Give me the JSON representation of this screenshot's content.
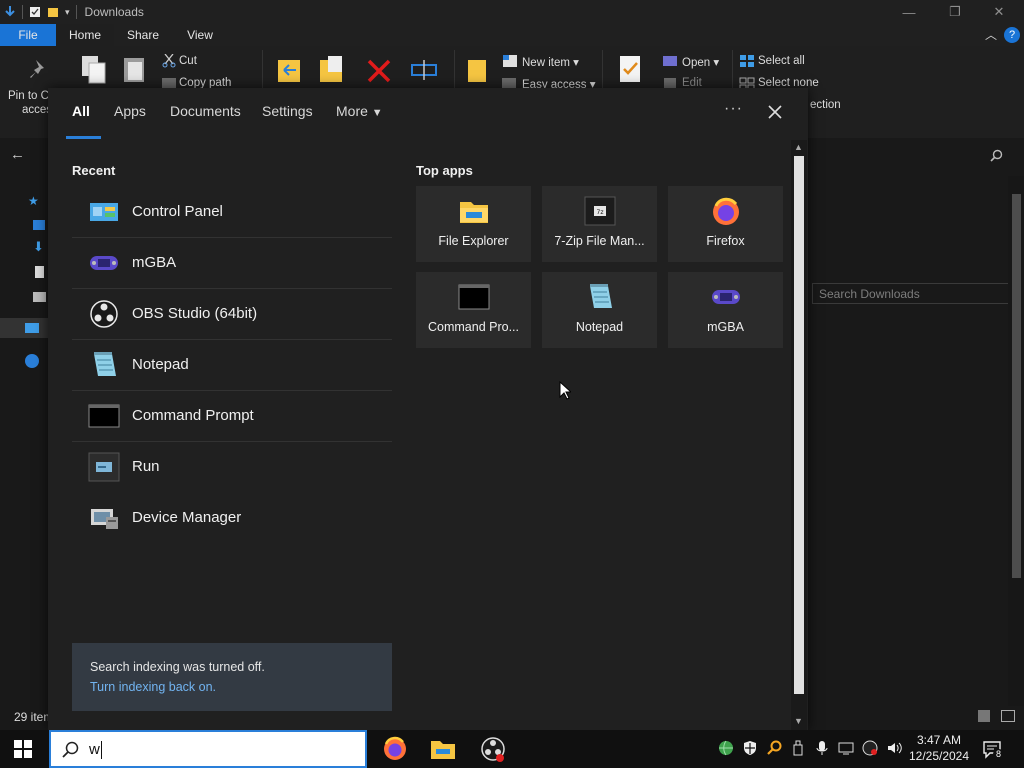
{
  "window": {
    "title": "Downloads",
    "tabs": {
      "file": "File",
      "home": "Home",
      "share": "Share",
      "view": "View"
    },
    "ribbon": {
      "pin_label": "Pin to C",
      "pin_label2": "acces",
      "cut": "Cut",
      "copy_path": "Copy path",
      "new_item": "New item",
      "easy_access": "Easy access",
      "open": "Open",
      "edit": "Edit",
      "select_all": "Select all",
      "select_none": "Select none",
      "invert_selection": "ection"
    },
    "search_placeholder": "Search Downloads",
    "status_items": "29 item"
  },
  "flyout": {
    "tabs": {
      "all": "All",
      "apps": "Apps",
      "documents": "Documents",
      "settings": "Settings",
      "more": "More"
    },
    "recent_title": "Recent",
    "recent": [
      {
        "label": "Control Panel",
        "icon": "control-panel-icon"
      },
      {
        "label": "mGBA",
        "icon": "mgba-icon"
      },
      {
        "label": "OBS Studio (64bit)",
        "icon": "obs-icon"
      },
      {
        "label": "Notepad",
        "icon": "notepad-icon"
      },
      {
        "label": "Command Prompt",
        "icon": "command-prompt-icon"
      },
      {
        "label": "Run",
        "icon": "run-icon"
      },
      {
        "label": "Device Manager",
        "icon": "device-manager-icon"
      }
    ],
    "top_apps_title": "Top apps",
    "top_apps": [
      {
        "label": "File Explorer",
        "icon": "file-explorer-icon"
      },
      {
        "label": "7-Zip File Man...",
        "icon": "seven-zip-icon"
      },
      {
        "label": "Firefox",
        "icon": "firefox-icon"
      },
      {
        "label": "Command Pro...",
        "icon": "command-prompt-icon"
      },
      {
        "label": "Notepad",
        "icon": "notepad-icon"
      },
      {
        "label": "mGBA",
        "icon": "mgba-icon"
      }
    ],
    "indexing_message": "Search indexing was turned off.",
    "indexing_link": "Turn indexing back on."
  },
  "taskbar": {
    "search_text": "w",
    "time": "3:47 AM",
    "date": "12/25/2024",
    "notification_count": "8"
  },
  "colors": {
    "accent": "#2a7fd9",
    "link": "#72b4f1",
    "flyout_bg": "#202020",
    "tile_bg": "#2b2b2b"
  }
}
